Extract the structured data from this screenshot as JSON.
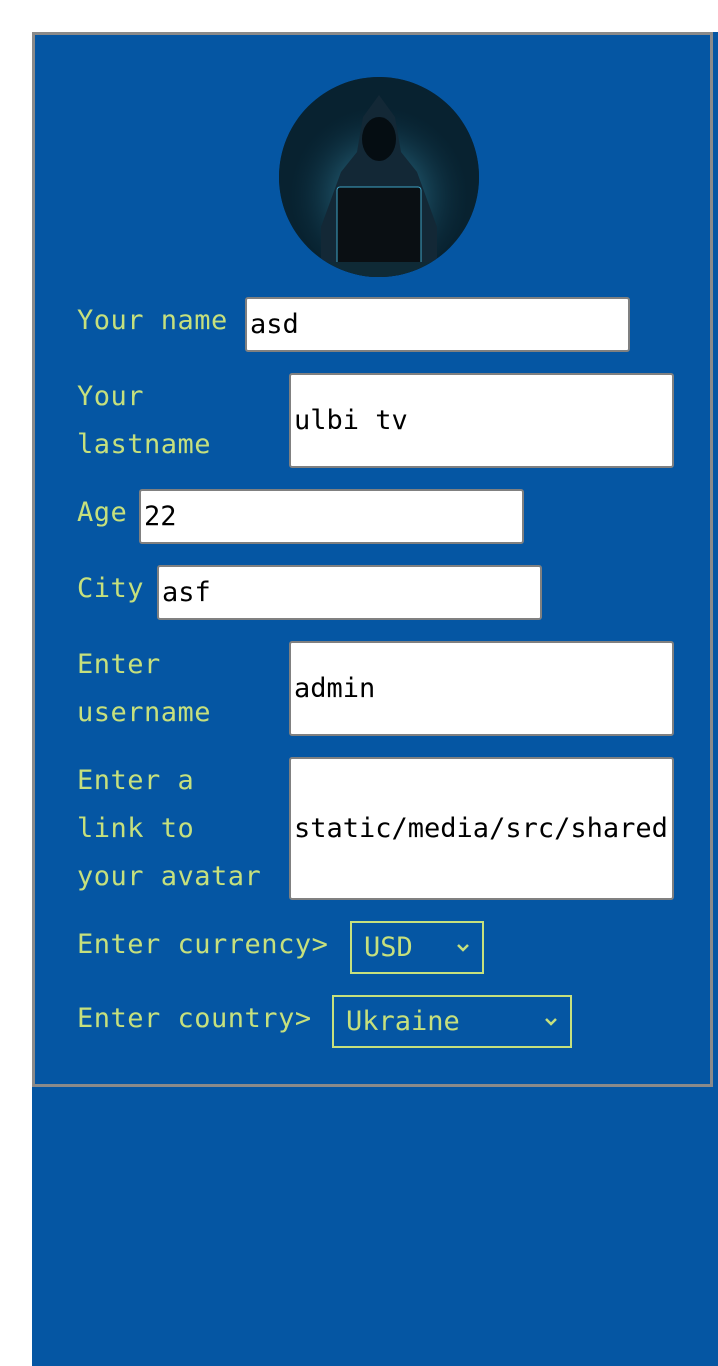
{
  "form": {
    "name": {
      "label": "Your name",
      "value": "asd"
    },
    "lastname": {
      "label": "Your\nlastname",
      "value": "ulbi tv"
    },
    "age": {
      "label": "Age",
      "value": "22"
    },
    "city": {
      "label": "City",
      "value": "asf"
    },
    "username": {
      "label": "Enter\nusername",
      "value": "admin"
    },
    "avatar_link": {
      "label": "Enter a\nlink to\nyour avatar",
      "value": "static/media/src/shared"
    },
    "currency": {
      "label": "Enter currency>",
      "selected": "USD"
    },
    "country": {
      "label": "Enter country>",
      "selected": "Ukraine"
    }
  },
  "colors": {
    "background": "#0556a3",
    "label": "#c6e07d",
    "card_border": "#8a8a8a"
  },
  "icons": {
    "avatar": "hooded-hacker-avatar",
    "select_arrow": "chevron-down-icon"
  }
}
